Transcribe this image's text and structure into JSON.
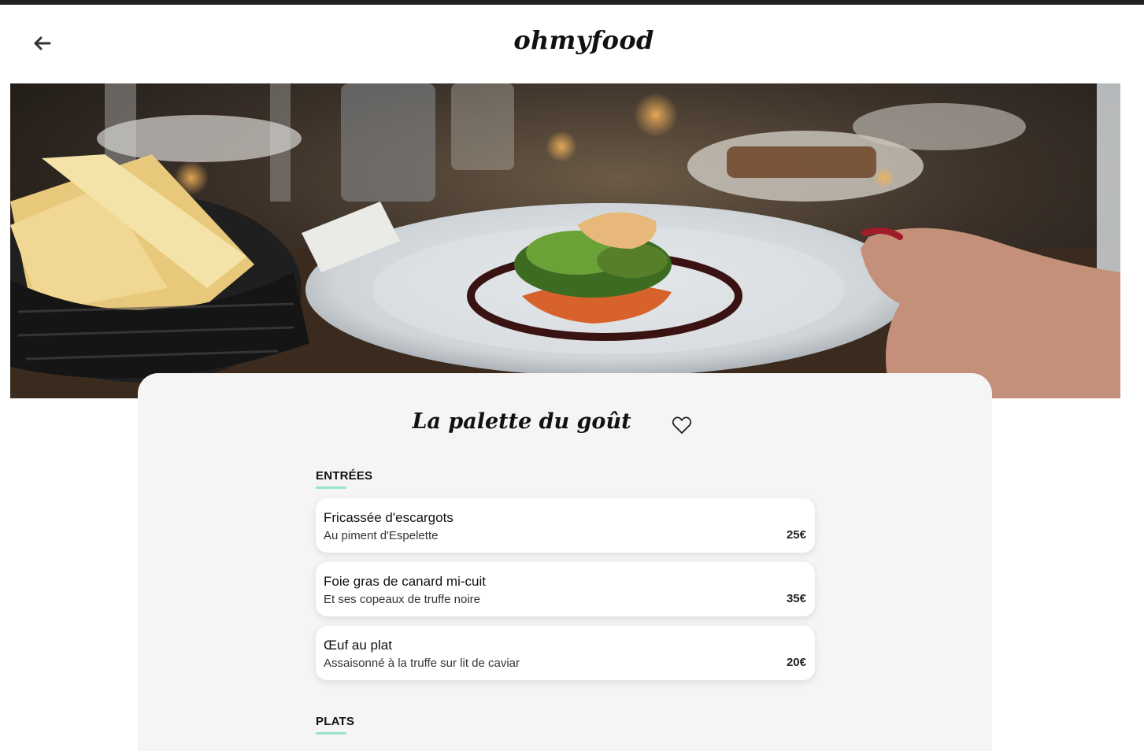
{
  "app": {
    "logo": "ohmyfood"
  },
  "header": {
    "back_icon": "arrow-left-icon"
  },
  "hero": {
    "alt": "plated fish dish on restaurant table"
  },
  "restaurant": {
    "name": "La palette du goût",
    "favorite_icon": "heart-outline-icon"
  },
  "menu": {
    "sections": [
      {
        "title": "ENTRÉES",
        "dishes": [
          {
            "name": "Fricassée d'escargots",
            "description": "Au piment d'Espelette",
            "price": "25€"
          },
          {
            "name": "Foie gras de canard mi-cuit",
            "description": "Et ses copeaux de truffe noire",
            "price": "35€"
          },
          {
            "name": "Œuf au plat",
            "description": "Assaisonné à la truffe sur lit de caviar",
            "price": "20€"
          }
        ]
      },
      {
        "title": "PLATS",
        "dishes": []
      }
    ]
  },
  "colors": {
    "accent": "#99e2d0",
    "card_bg": "#f5f5f5",
    "topbar": "#222222"
  }
}
